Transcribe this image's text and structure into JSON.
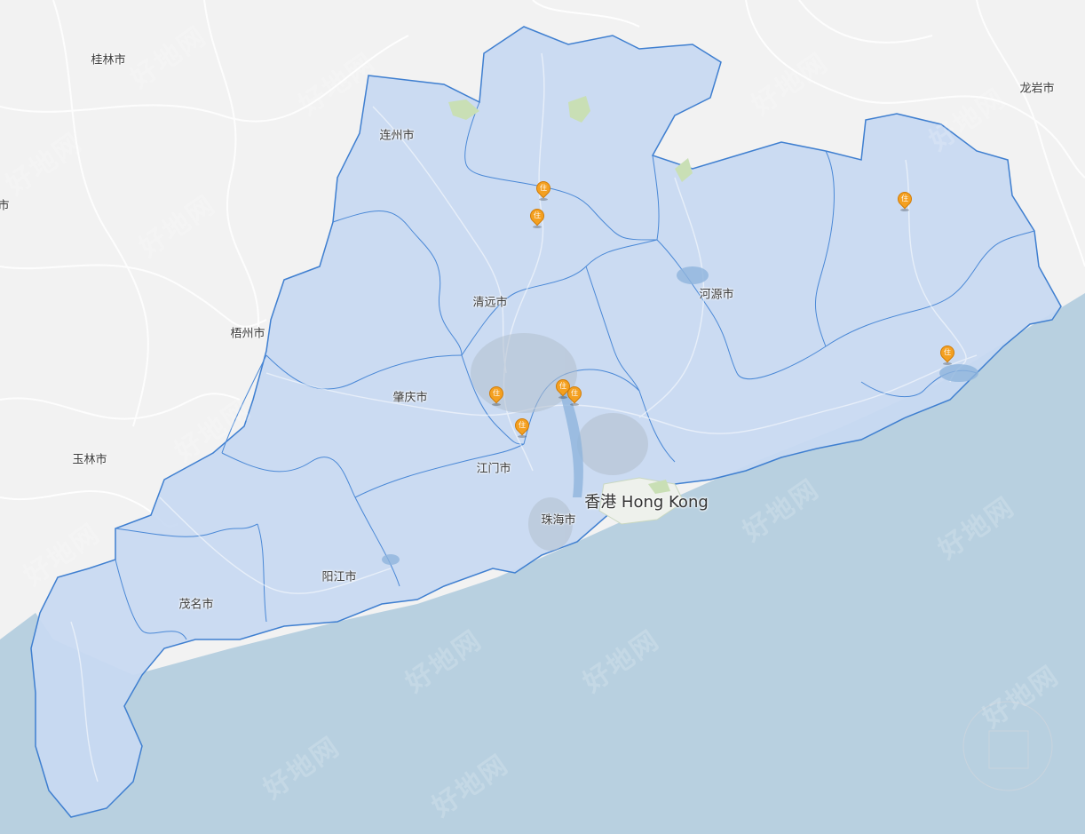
{
  "map": {
    "colors": {
      "land": "#f2f2f2",
      "sea": "#b8d0e0",
      "region_fill": "#c8d9f2",
      "region_border": "#3f7fd0",
      "marker": "#f4a020",
      "road": "#ffffff",
      "green": "#c9dfb5"
    },
    "region_labels": [
      {
        "id": "lianzhou",
        "text": "连州市"
      },
      {
        "id": "qingyuan",
        "text": "清远市"
      },
      {
        "id": "heyuan",
        "text": "河源市"
      },
      {
        "id": "zhaoqing",
        "text": "肇庆市"
      },
      {
        "id": "jiangmen",
        "text": "江门市"
      },
      {
        "id": "zhuhai",
        "text": "珠海市"
      },
      {
        "id": "yangjiang",
        "text": "阳江市"
      },
      {
        "id": "maoming",
        "text": "茂名市"
      }
    ],
    "outside_labels": [
      {
        "id": "guilin",
        "text": "桂林市"
      },
      {
        "id": "wuzhou",
        "text": "梧州市"
      },
      {
        "id": "yulin",
        "text": "玉林市"
      },
      {
        "id": "longyan",
        "text": "龙岩市"
      },
      {
        "id": "left-edge",
        "text": "市"
      }
    ],
    "major_label": {
      "text": "香港 Hong Kong"
    },
    "markers": [
      {
        "id": "m1",
        "icon": "住"
      },
      {
        "id": "m2",
        "icon": "住"
      },
      {
        "id": "m3",
        "icon": "住"
      },
      {
        "id": "m4",
        "icon": "住"
      },
      {
        "id": "m5",
        "icon": "住"
      },
      {
        "id": "m6",
        "icon": "住"
      },
      {
        "id": "m7",
        "icon": "住"
      },
      {
        "id": "m8",
        "icon": "住"
      }
    ],
    "watermark": "好地网"
  }
}
